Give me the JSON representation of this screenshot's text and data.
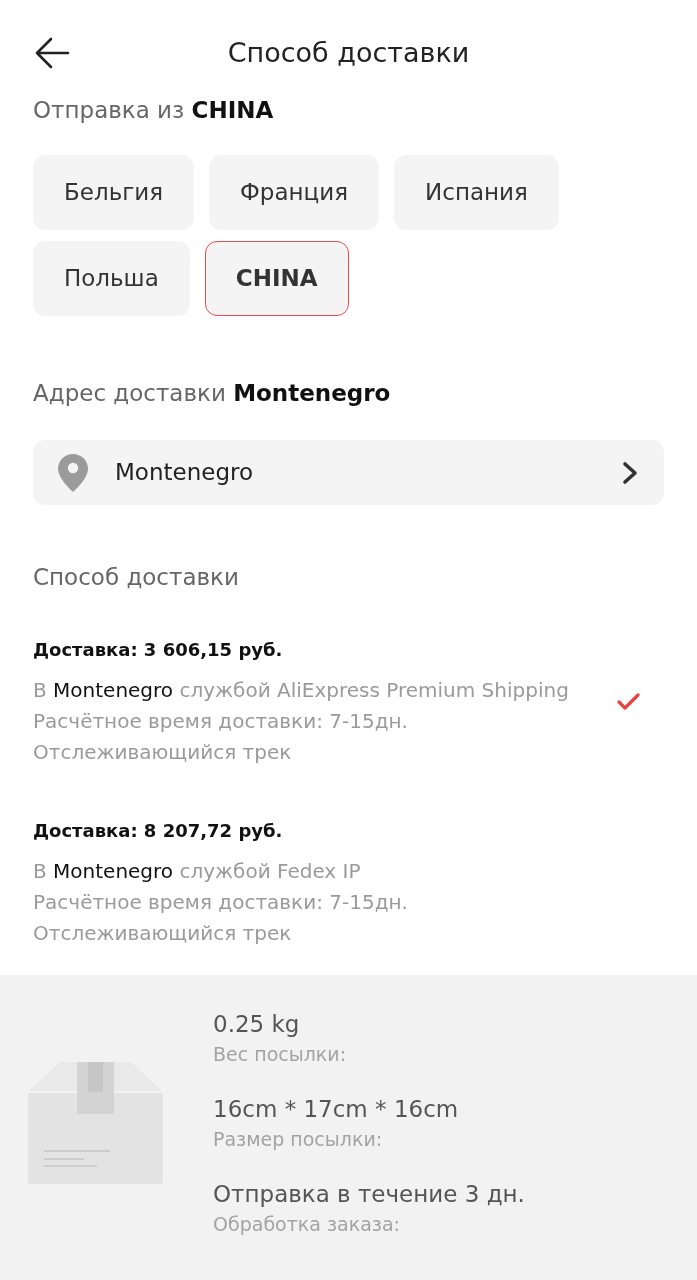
{
  "header": {
    "title": "Способ доставки"
  },
  "ship_from": {
    "label": "Отправка из **CHINA**",
    "options": [
      {
        "label": "Бельгия",
        "selected": false
      },
      {
        "label": "Франция",
        "selected": false
      },
      {
        "label": "Испания",
        "selected": false
      },
      {
        "label": "Польша",
        "selected": false
      },
      {
        "label": "CHINA",
        "selected": true
      }
    ]
  },
  "address": {
    "label": "Адрес доставки **Montenegro**",
    "value": "Montenegro"
  },
  "shipping": {
    "heading": "Способ доставки",
    "options": [
      {
        "price": "Доставка: 3 606,15 руб.",
        "route_prefix": "В",
        "destination": "Montenegro",
        "carrier": "службой AliExpress Premium Shipping",
        "estimate": "Расчётное время доставки: 7-15дн.",
        "tracking": "Отслеживающийся трек",
        "selected": true
      },
      {
        "price": "Доставка: 8 207,72 руб.",
        "route_prefix": "В",
        "destination": "Montenegro",
        "carrier": "службой Fedex IP",
        "estimate": "Расчётное время доставки: 7-15дн.",
        "tracking": "Отслеживающийся трек",
        "selected": false
      }
    ]
  },
  "package": {
    "details": [
      {
        "value": "0.25 kg",
        "label": "Вес посылки:"
      },
      {
        "value": "16cm * 17cm * 16cm",
        "label": "Размер посылки:"
      },
      {
        "value": "Отправка в течение 3 дн.",
        "label": "Обработка заказа:"
      }
    ]
  }
}
